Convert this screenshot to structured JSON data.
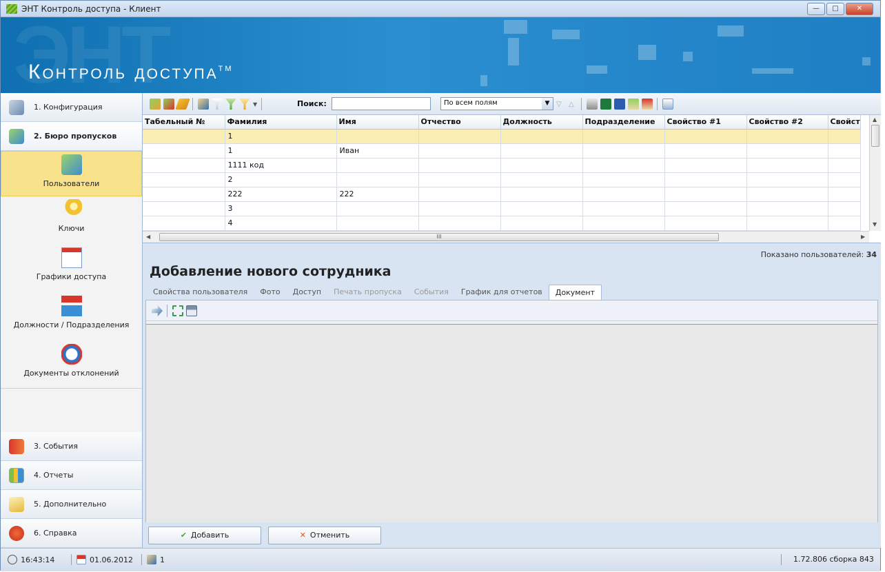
{
  "window": {
    "title": "ЭНТ Контроль доступа - Клиент",
    "min_label": "—",
    "max_label": "□",
    "close_label": "✕"
  },
  "banner": {
    "logo_text": "Контроль доступа",
    "logo_tm": "TM",
    "ghost_text": "ЭНТ"
  },
  "sidebar": {
    "top_sections": [
      {
        "label": "1. Конфигурация",
        "icon": "wrench-icon"
      },
      {
        "label": "2. Бюро пропусков",
        "icon": "id-card-icon"
      }
    ],
    "sub_items": [
      {
        "label": "Пользователи",
        "icon": "users-card-icon",
        "selected": true
      },
      {
        "label": "Ключи",
        "icon": "key-icon"
      },
      {
        "label": "Графики доступа",
        "icon": "calendar-grid-icon"
      },
      {
        "label": "Должности / Подразделения",
        "icon": "org-structure-icon"
      },
      {
        "label": "Документы отклонений",
        "icon": "alarm-clock-icon"
      }
    ],
    "bottom_sections": [
      {
        "label": "3. События",
        "icon": "events-book-icon"
      },
      {
        "label": "4. Отчеты",
        "icon": "bar-chart-icon"
      },
      {
        "label": "5. Дополнительно",
        "icon": "envelope-icon"
      },
      {
        "label": "6. Справка",
        "icon": "help-icon"
      }
    ]
  },
  "toolbar": {
    "search_label": "Поиск:",
    "search_value": "",
    "scope_value": "По всем полям"
  },
  "grid": {
    "columns": [
      "Табельный №",
      "Фамилия",
      "Имя",
      "Отчество",
      "Должность",
      "Подразделение",
      "Свойство #1",
      "Свойство #2",
      "Свойст"
    ],
    "rows": [
      [
        "",
        "1",
        "",
        "",
        "",
        "",
        "",
        "",
        ""
      ],
      [
        "",
        "1",
        "Иван",
        "",
        "",
        "",
        "",
        "",
        ""
      ],
      [
        "",
        "1111 код",
        "",
        "",
        "",
        "",
        "",
        "",
        ""
      ],
      [
        "",
        "2",
        "",
        "",
        "",
        "",
        "",
        "",
        ""
      ],
      [
        "",
        "222",
        "222",
        "",
        "",
        "",
        "",
        "",
        ""
      ],
      [
        "",
        "3",
        "",
        "",
        "",
        "",
        "",
        "",
        ""
      ],
      [
        "",
        "4",
        "",
        "",
        "",
        "",
        "",
        "",
        ""
      ]
    ],
    "hscroll_grip": "III"
  },
  "shown": {
    "label": "Показано пользователей:",
    "count": "34"
  },
  "form": {
    "title": "Добавление нового сотрудника",
    "tabs": [
      {
        "label": "Свойства пользователя",
        "state": "normal"
      },
      {
        "label": "Фото",
        "state": "normal"
      },
      {
        "label": "Доступ",
        "state": "normal"
      },
      {
        "label": "Печать пропуска",
        "state": "disabled"
      },
      {
        "label": "События",
        "state": "disabled"
      },
      {
        "label": "График для отчетов",
        "state": "normal"
      },
      {
        "label": "Документ",
        "state": "active"
      }
    ],
    "add_label": "Добавить",
    "cancel_label": "Отменить",
    "add_glyph": "✔",
    "cancel_glyph": "✕"
  },
  "status": {
    "time": "16:43:14",
    "date": "01.06.2012",
    "users_online": "1",
    "version": "1.72.806 сборка 843"
  },
  "colors": {
    "banner": "#1f7fc4",
    "selected_nav": "#f8e38c",
    "selected_row": "#fbeeb5"
  }
}
